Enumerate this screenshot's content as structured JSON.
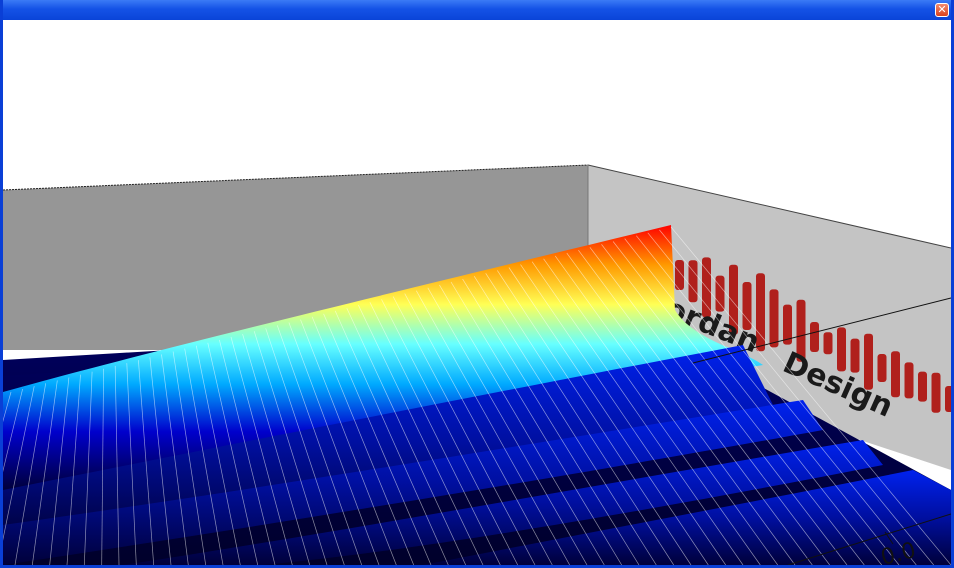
{
  "window": {
    "title": "",
    "close_glyph": "✕",
    "frame_color": "#0a3fd6"
  },
  "plot": {
    "type": "3d-waterfall-surface",
    "colormap": [
      "#00003a",
      "#0000cc",
      "#00aaff",
      "#66ffff",
      "#ffff55",
      "#ff9900",
      "#ff0000"
    ],
    "back_wall_color": "#969696",
    "side_wall_color": "#c4c4c4"
  },
  "watermark": {
    "text_partial": "ordan",
    "text_word": "Design",
    "bar_color": "#b0201c"
  },
  "axis": {
    "tick_label": "0.0"
  }
}
